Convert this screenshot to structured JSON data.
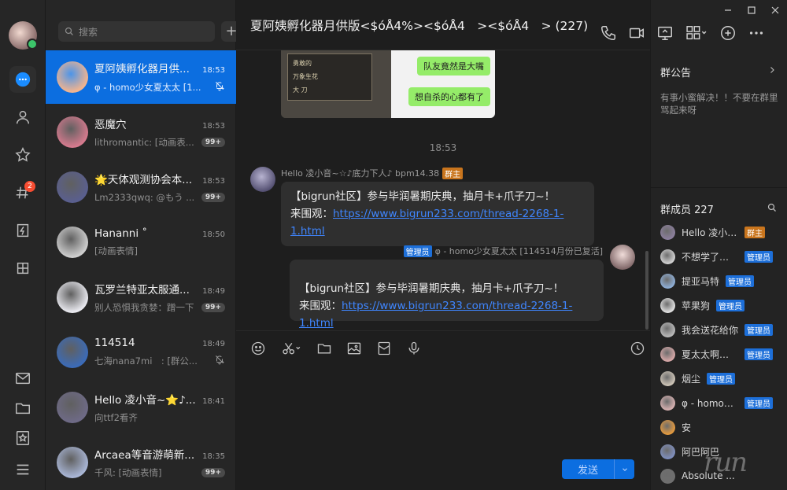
{
  "rail": {
    "badge_count": "2"
  },
  "search": {
    "placeholder": "搜索",
    "add_label": "+"
  },
  "conversations": [
    {
      "name": "夏阿姨孵化器月供...",
      "time": "18:53",
      "preview": "φ - homo少女夏太太 [1...",
      "trail": "mute",
      "color": "#f2b48f"
    },
    {
      "name": "恶魔穴",
      "time": "18:53",
      "preview": "lithromantic: [动画表...",
      "trail": "99+",
      "color": "#d67a8e"
    },
    {
      "name": "🌟天体观测协会本...",
      "time": "18:53",
      "preview": "Lm2333qwq: @もう ...",
      "trail": "99+",
      "color": "#5a5f8f"
    },
    {
      "name": "Hananni ˚",
      "time": "18:50",
      "preview": "[动画表情]",
      "trail": "",
      "color": "#cfcfcf"
    },
    {
      "name": "瓦罗兰特亚太服通...",
      "time": "18:49",
      "preview": "别人恐惧我贪婪：蹭一下",
      "trail": "99+",
      "color": "#e9e9ef"
    },
    {
      "name": "114514",
      "time": "18:49",
      "preview": "七海nana7mi　: [群公...",
      "trail": "mute",
      "color": "#3b6bb8"
    },
    {
      "name": "Hello 凌小音~⭐♪...",
      "time": "18:41",
      "preview": "向ttf2看齐",
      "trail": "",
      "color": "#6e6a86"
    },
    {
      "name": "Arcaea等音游萌新...",
      "time": "18:35",
      "preview": "千风: [动画表情]",
      "trail": "99+",
      "color": "#a9b6d6"
    }
  ],
  "chat": {
    "title": "夏阿姨孵化器月供版<$óÅ4%><$óÅ4　><$óÅ4　> (227)",
    "image_bubbles": [
      "队友竟然是大嘴",
      "想自杀的心都有了"
    ],
    "image_panel_lines": [
      "勇敢的",
      "万象生花",
      "大 刀"
    ],
    "timestamp": "18:53",
    "msg1": {
      "sender": "Hello 凌小音~☆♪底力下人♪ bpm14.38",
      "tag": "群主",
      "line1": "【bigrun社区】参与毕润暑期庆典，抽月卡+爪子刀~！",
      "line2_prefix": "来围观：",
      "link": "https://www.bigrun233.com/thread-2268-1-1.html"
    },
    "msg2": {
      "tag": "管理员",
      "sender": "φ - homo少女夏太太 [114514月份已复活]",
      "line1": "【bigrun社区】参与毕润暑期庆典，抽月卡+爪子刀~！",
      "line2_prefix": "来围观：",
      "link": "https://www.bigrun233.com/thread-2268-1-1.html"
    },
    "send_label": "发送"
  },
  "side": {
    "notice_title": "群公告",
    "notice_text": "有事小蜜解决！！不要在群里骂起来呀",
    "members_title": "群成员 227",
    "members": [
      {
        "name": "Hello 凌小音~...",
        "tag": "群主",
        "color": "#8c7f9e"
      },
      {
        "name": "不想学了，我...",
        "tag": "管理员",
        "color": "#d3d3d3"
      },
      {
        "name": "提亚马特",
        "tag": "管理员",
        "color": "#8fb0d9"
      },
      {
        "name": "苹果狗",
        "tag": "管理员",
        "color": "#e3e3e3"
      },
      {
        "name": "我会送花给你",
        "tag": "管理员",
        "color": "#bbbbbb"
      },
      {
        "name": "夏太太啊、猫...",
        "tag": "管理员",
        "color": "#d9a9a9"
      },
      {
        "name": "烟尘",
        "tag": "管理员",
        "color": "#cfc6b8"
      },
      {
        "name": "φ - homo少...",
        "tag": "管理员",
        "color": "#d8b2b2"
      },
      {
        "name": "安",
        "tag": "",
        "color": "#e59a3d"
      },
      {
        "name": "阿巴阿巴",
        "tag": "",
        "color": "#7f8fbf"
      },
      {
        "name": "Absolute ...",
        "tag": "",
        "color": "#6f6f6f"
      }
    ]
  },
  "watermark": "run"
}
